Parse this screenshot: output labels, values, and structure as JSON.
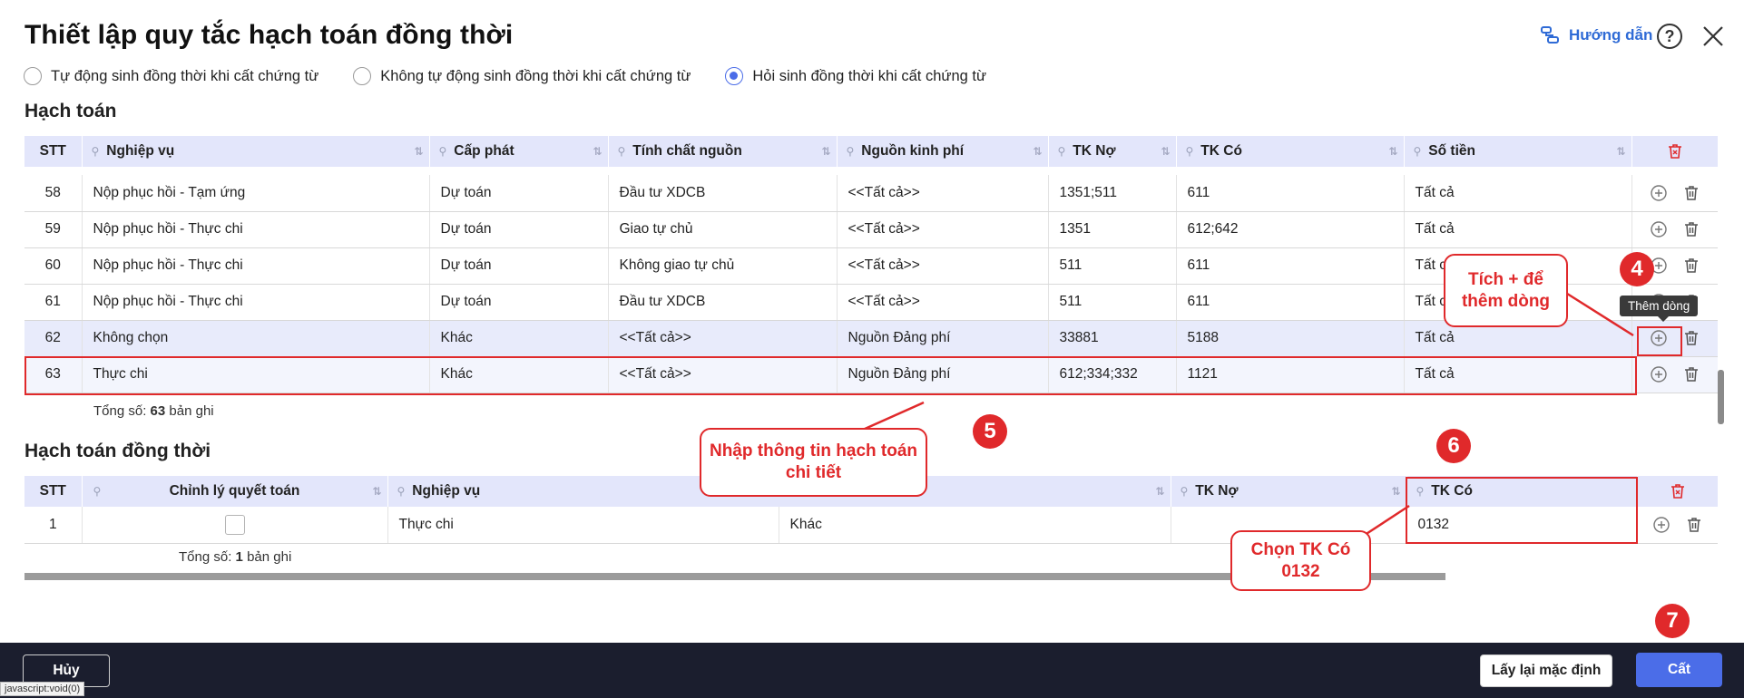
{
  "header": {
    "title": "Thiết lập quy tắc hạch toán đồng thời",
    "guide_label": "Hướng dẫn",
    "help_symbol": "?"
  },
  "options": [
    {
      "label": "Tự động sinh đồng thời khi cất chứng từ",
      "checked": false
    },
    {
      "label": "Không tự động sinh đồng thời khi cất chứng từ",
      "checked": false
    },
    {
      "label": "Hỏi sinh đồng thời khi cất chứng từ",
      "checked": true
    }
  ],
  "hach_toan": {
    "title": "Hạch toán",
    "columns": {
      "stt": "STT",
      "nghiep_vu": "Nghiệp vụ",
      "cap_phat": "Cấp phát",
      "tinh_chat": "Tính chất nguồn",
      "nguon_kp": "Nguồn kinh phí",
      "tk_no": "TK Nợ",
      "tk_co": "TK Có",
      "so_tien": "Số tiền"
    },
    "rows": [
      {
        "stt": "58",
        "nghiep_vu": "Nộp phục hồi - Tạm ứng",
        "cap_phat": "Dự toán",
        "tinh_chat": "Đầu tư XDCB",
        "nguon_kp": "<<Tất cả>>",
        "tk_no": "1351;511",
        "tk_co": "611",
        "so_tien": "Tất cả"
      },
      {
        "stt": "59",
        "nghiep_vu": "Nộp phục hồi - Thực chi",
        "cap_phat": "Dự toán",
        "tinh_chat": "Giao tự chủ",
        "nguon_kp": "<<Tất cả>>",
        "tk_no": "1351",
        "tk_co": "612;642",
        "so_tien": "Tất cả"
      },
      {
        "stt": "60",
        "nghiep_vu": "Nộp phục hồi - Thực chi",
        "cap_phat": "Dự toán",
        "tinh_chat": "Không giao tự chủ",
        "nguon_kp": "<<Tất cả>>",
        "tk_no": "511",
        "tk_co": "611",
        "so_tien": "Tất cả"
      },
      {
        "stt": "61",
        "nghiep_vu": "Nộp phục hồi - Thực chi",
        "cap_phat": "Dự toán",
        "tinh_chat": "Đầu tư XDCB",
        "nguon_kp": "<<Tất cả>>",
        "tk_no": "511",
        "tk_co": "611",
        "so_tien": "Tất cả"
      },
      {
        "stt": "62",
        "nghiep_vu": "Không chọn",
        "cap_phat": "Khác",
        "tinh_chat": "<<Tất cả>>",
        "nguon_kp": "Nguồn Đảng phí",
        "tk_no": "33881",
        "tk_co": "5188",
        "so_tien": "Tất cả"
      },
      {
        "stt": "63",
        "nghiep_vu": "Thực chi",
        "cap_phat": "Khác",
        "tinh_chat": "<<Tất cả>>",
        "nguon_kp": "Nguồn Đảng phí",
        "tk_no": "612;334;332",
        "tk_co": "1121",
        "so_tien": "Tất cả"
      }
    ],
    "total_prefix": "Tổng số:",
    "total_count": "63",
    "total_suffix": "bản ghi"
  },
  "dong_thoi": {
    "title": "Hạch toán đồng thời",
    "columns": {
      "stt": "STT",
      "chinh_ly": "Chỉnh lý quyết toán",
      "nghiep_vu": "Nghiệp vụ",
      "tk_no": "TK Nợ",
      "tk_co": "TK Có"
    },
    "rows": [
      {
        "stt": "1",
        "nghiep_vu": "Thực chi",
        "cap_phat": "Khác",
        "tk_no": "",
        "tk_co": "0132"
      }
    ],
    "total_prefix": "Tổng số:",
    "total_count": "1",
    "total_suffix": "bản ghi"
  },
  "tooltip": "Thêm dòng",
  "annotations": {
    "note_4": "Tích + để thêm dòng",
    "note_5": "Nhập thông tin hạch toán chi tiết",
    "note_6": "Chọn TK Có 0132",
    "badges": [
      "4",
      "5",
      "6",
      "7"
    ]
  },
  "footer": {
    "cancel": "Hủy",
    "reset": "Lấy lại mặc định",
    "save": "Cất"
  },
  "status_url": "javascript:void(0)",
  "colors": {
    "accent": "#4b6de8",
    "annotation_red": "#e0292b",
    "header_bg": "#e3e6fb",
    "bottom_bar": "#1b1e2e"
  }
}
